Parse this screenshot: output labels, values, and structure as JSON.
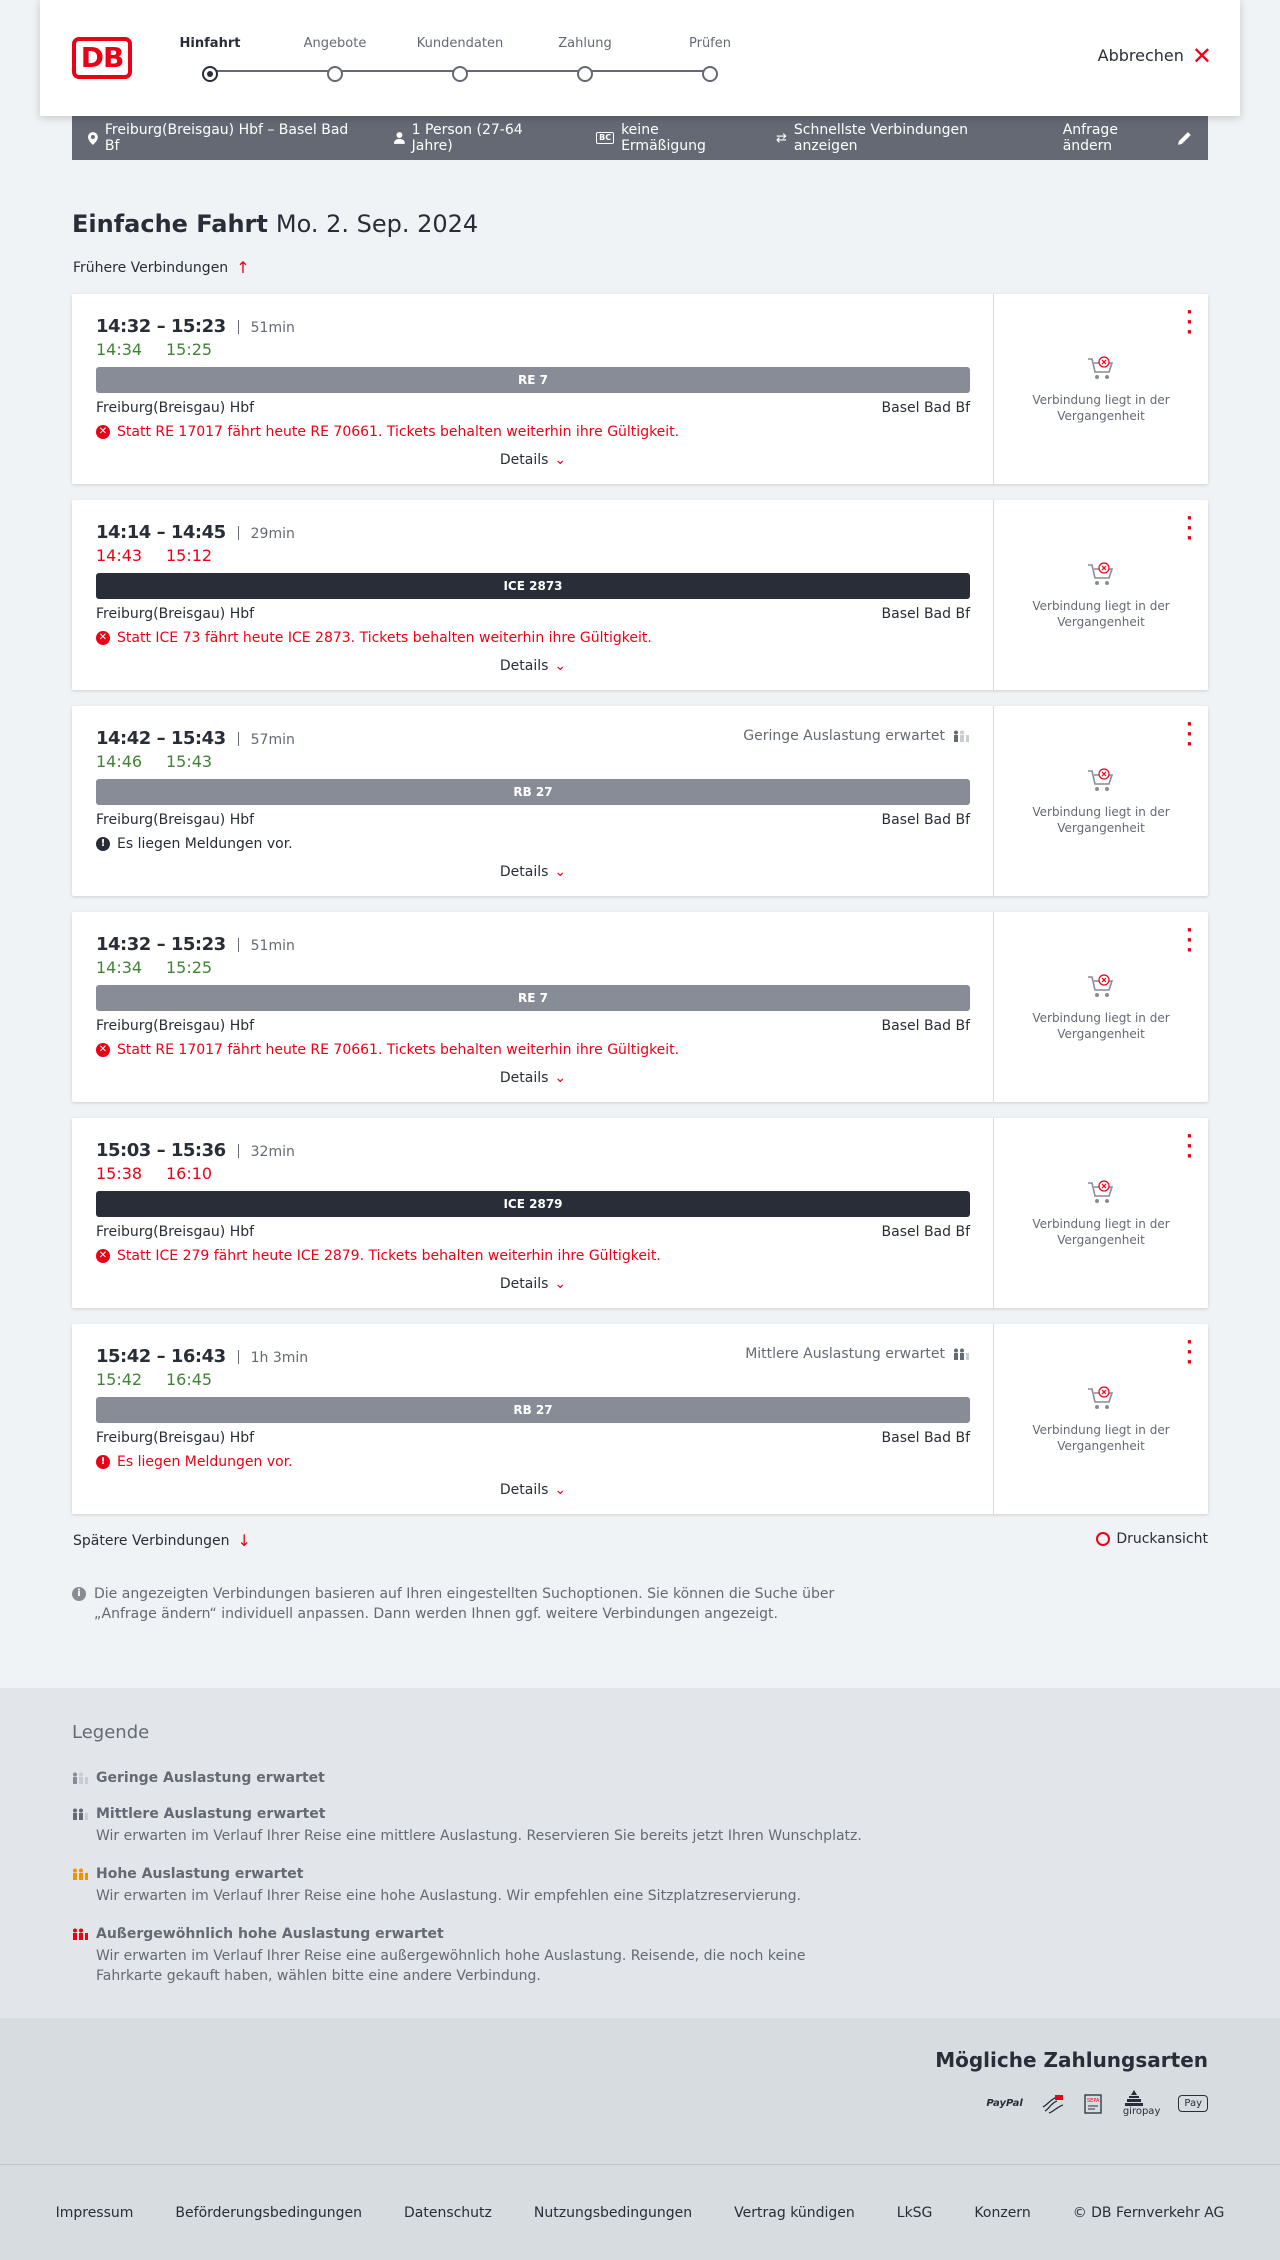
{
  "header": {
    "logo": "DB",
    "steps": [
      "Hinfahrt",
      "Angebote",
      "Kundendaten",
      "Zahlung",
      "Prüfen"
    ],
    "cancel": "Abbrechen"
  },
  "summary": {
    "route": "Freiburg(Breisgau) Hbf – Basel Bad Bf",
    "passengers": "1 Person (27-64 Jahre)",
    "discount_badge": "BC",
    "discount": "keine Ermäßigung",
    "fastest": "Schnellste Verbindungen anzeigen",
    "edit": "Anfrage ändern"
  },
  "title": {
    "main": "Einfache Fahrt",
    "date": "Mo. 2. Sep. 2024"
  },
  "earlier": "Frühere Verbindungen",
  "later": "Spätere Verbindungen",
  "print": "Druckansicht",
  "details_label": "Details",
  "past_label": "Verbindung liegt in der Vergangenheit",
  "connections": [
    {
      "times": "14:32 – 15:23",
      "duration": "51min",
      "rt_dep": "14:34",
      "rt_arr": "15:25",
      "rt_color": "green",
      "train": "RE 7",
      "train_style": "grey",
      "from": "Freiburg(Breisgau) Hbf",
      "to": "Basel Bad Bf",
      "msg": "Statt RE 17017 fährt heute RE 70661. Tickets behalten weiterhin ihre Gültigkeit.",
      "msg_type": "error",
      "load": ""
    },
    {
      "times": "14:14 – 14:45",
      "duration": "29min",
      "rt_dep": "14:43",
      "rt_arr": "15:12",
      "rt_color": "red",
      "train": "ICE 2873",
      "train_style": "dark",
      "from": "Freiburg(Breisgau) Hbf",
      "to": "Basel Bad Bf",
      "msg": "Statt ICE 73 fährt heute ICE 2873. Tickets behalten weiterhin ihre Gültigkeit.",
      "msg_type": "error",
      "load": ""
    },
    {
      "times": "14:42 – 15:43",
      "duration": "57min",
      "rt_dep": "14:46",
      "rt_arr": "15:43",
      "rt_color": "green",
      "train": "RB 27",
      "train_style": "grey",
      "from": "Freiburg(Breisgau) Hbf",
      "to": "Basel Bad Bf",
      "msg": "Es liegen Meldungen vor.",
      "msg_type": "info",
      "load": "Geringe Auslastung erwartet"
    },
    {
      "times": "14:32 – 15:23",
      "duration": "51min",
      "rt_dep": "14:34",
      "rt_arr": "15:25",
      "rt_color": "green",
      "train": "RE 7",
      "train_style": "grey",
      "from": "Freiburg(Breisgau) Hbf",
      "to": "Basel Bad Bf",
      "msg": "Statt RE 17017 fährt heute RE 70661. Tickets behalten weiterhin ihre Gültigkeit.",
      "msg_type": "error",
      "load": ""
    },
    {
      "times": "15:03 – 15:36",
      "duration": "32min",
      "rt_dep": "15:38",
      "rt_arr": "16:10",
      "rt_color": "red",
      "train": "ICE 2879",
      "train_style": "dark",
      "from": "Freiburg(Breisgau) Hbf",
      "to": "Basel Bad Bf",
      "msg": "Statt ICE 279 fährt heute ICE 2879. Tickets behalten weiterhin ihre Gültigkeit.",
      "msg_type": "error",
      "load": ""
    },
    {
      "times": "15:42 – 16:43",
      "duration": "1h 3min",
      "rt_dep": "15:42",
      "rt_arr": "16:45",
      "rt_color": "green",
      "train": "RB 27",
      "train_style": "grey",
      "from": "Freiburg(Breisgau) Hbf",
      "to": "Basel Bad Bf",
      "msg": "Es liegen Meldungen vor.",
      "msg_type": "warn",
      "load": "Mittlere Auslastung erwartet"
    }
  ],
  "info": "Die angezeigten Verbindungen basieren auf Ihren eingestellten Suchoptionen. Sie können die Suche über „Anfrage ändern“ individuell anpassen. Dann werden Ihnen ggf. weitere Verbindungen angezeigt.",
  "legend": {
    "title": "Legende",
    "items": [
      {
        "title": "Geringe Auslastung erwartet",
        "desc": "",
        "color": "#878c96"
      },
      {
        "title": "Mittlere Auslastung erwartet",
        "desc": "Wir erwarten im Verlauf Ihrer Reise eine mittlere Auslastung. Reservieren Sie bereits jetzt Ihren Wunschplatz.",
        "color": "#646973"
      },
      {
        "title": "Hohe Auslastung erwartet",
        "desc": "Wir erwarten im Verlauf Ihrer Reise eine hohe Auslastung. Wir empfehlen eine Sitzplatzreservierung.",
        "color": "#f39200"
      },
      {
        "title": "Außergewöhnlich hohe Auslastung erwartet",
        "desc": "Wir erwarten im Verlauf Ihrer Reise eine außergewöhnlich hohe Auslastung. Reisende, die noch keine Fahrkarte gekauft haben, wählen bitte eine andere Verbindung.",
        "color": "#ec0016"
      }
    ]
  },
  "payment": {
    "title": "Mögliche Zahlungsarten",
    "methods": [
      "PayPal",
      "",
      "SEPA",
      "giropay",
      "Pay"
    ]
  },
  "footer": [
    "Impressum",
    "Beförderungsbedingungen",
    "Datenschutz",
    "Nutzungsbedingungen",
    "Vertrag kündigen",
    "LkSG",
    "Konzern",
    "© DB Fernverkehr AG"
  ]
}
